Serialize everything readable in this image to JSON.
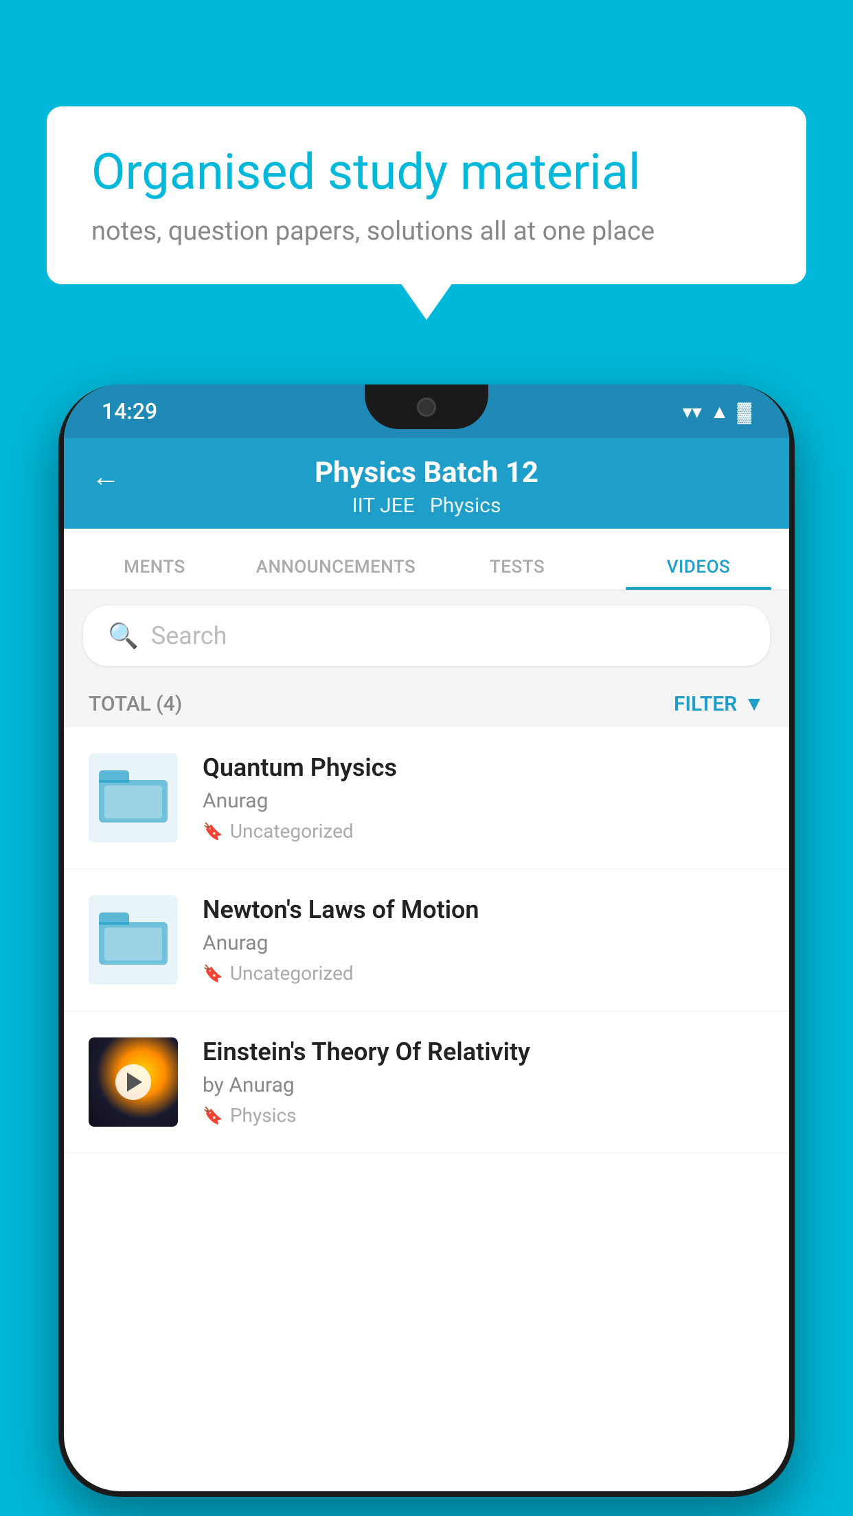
{
  "background_color": "#00b8d9",
  "speech_bubble": {
    "headline": "Organised study material",
    "subtext": "notes, question papers, solutions all at one place"
  },
  "status_bar": {
    "time": "14:29",
    "wifi": "▾",
    "signal": "▲",
    "battery": "▓"
  },
  "app_bar": {
    "back_label": "←",
    "title": "Physics Batch 12",
    "subtitle_left": "IIT JEE",
    "subtitle_right": "Physics"
  },
  "tabs": [
    {
      "label": "MENTS",
      "active": false
    },
    {
      "label": "ANNOUNCEMENTS",
      "active": false
    },
    {
      "label": "TESTS",
      "active": false
    },
    {
      "label": "VIDEOS",
      "active": true
    }
  ],
  "search": {
    "placeholder": "Search"
  },
  "filter_bar": {
    "total_label": "TOTAL (4)",
    "filter_label": "FILTER"
  },
  "videos": [
    {
      "title": "Quantum Physics",
      "author": "Anurag",
      "tag": "Uncategorized",
      "type": "folder"
    },
    {
      "title": "Newton's Laws of Motion",
      "author": "Anurag",
      "tag": "Uncategorized",
      "type": "folder"
    },
    {
      "title": "Einstein's Theory Of Relativity",
      "author": "by Anurag",
      "tag": "Physics",
      "type": "video"
    }
  ]
}
